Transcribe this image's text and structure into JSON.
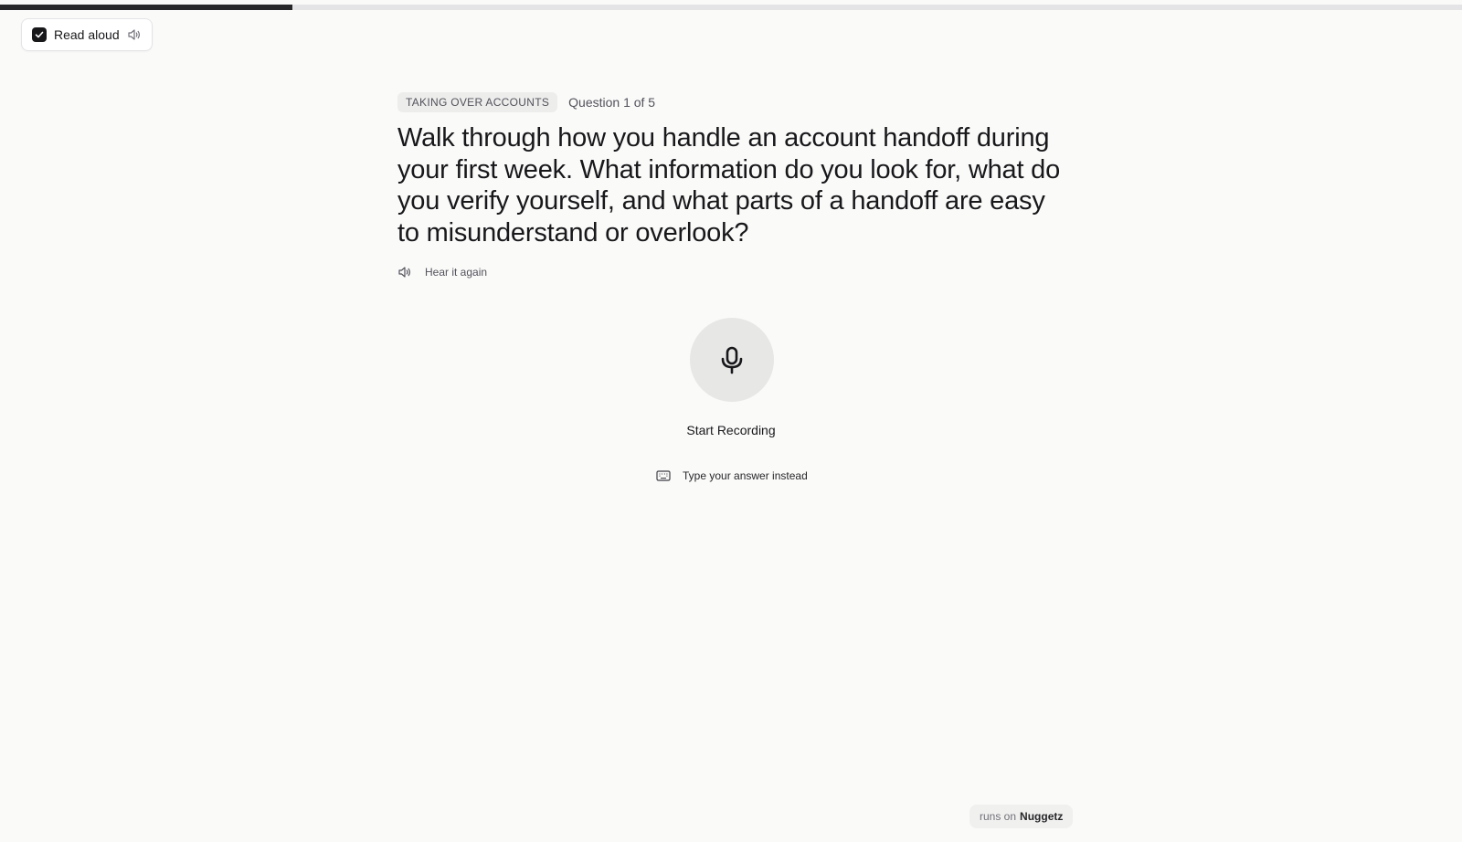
{
  "progress": {
    "fraction": 0.2
  },
  "read_aloud": {
    "label": "Read aloud",
    "checked": true,
    "check_icon": "check-icon",
    "speaker_icon": "speaker-icon"
  },
  "question": {
    "category": "TAKING OVER ACCOUNTS",
    "counter": "Question 1 of 5",
    "text": "Walk through how you handle an account handoff during your first week. What information do you look for, what do you verify yourself, and what parts of a handoff are easy to misunderstand or overlook?",
    "hear_again_label": "Hear it again",
    "hear_again_icon": "speaker-icon"
  },
  "recording": {
    "mic_icon": "microphone-icon",
    "start_label": "Start Recording"
  },
  "type_instead": {
    "icon": "keyboard-icon",
    "label": "Type your answer instead"
  },
  "footer": {
    "prefix": "runs on",
    "brand": "Nuggetz"
  },
  "colors": {
    "background": "#fafaf9",
    "progress_fill": "#27272a",
    "progress_track": "#e4e4e7",
    "mic_circle": "#e7e7e6"
  }
}
